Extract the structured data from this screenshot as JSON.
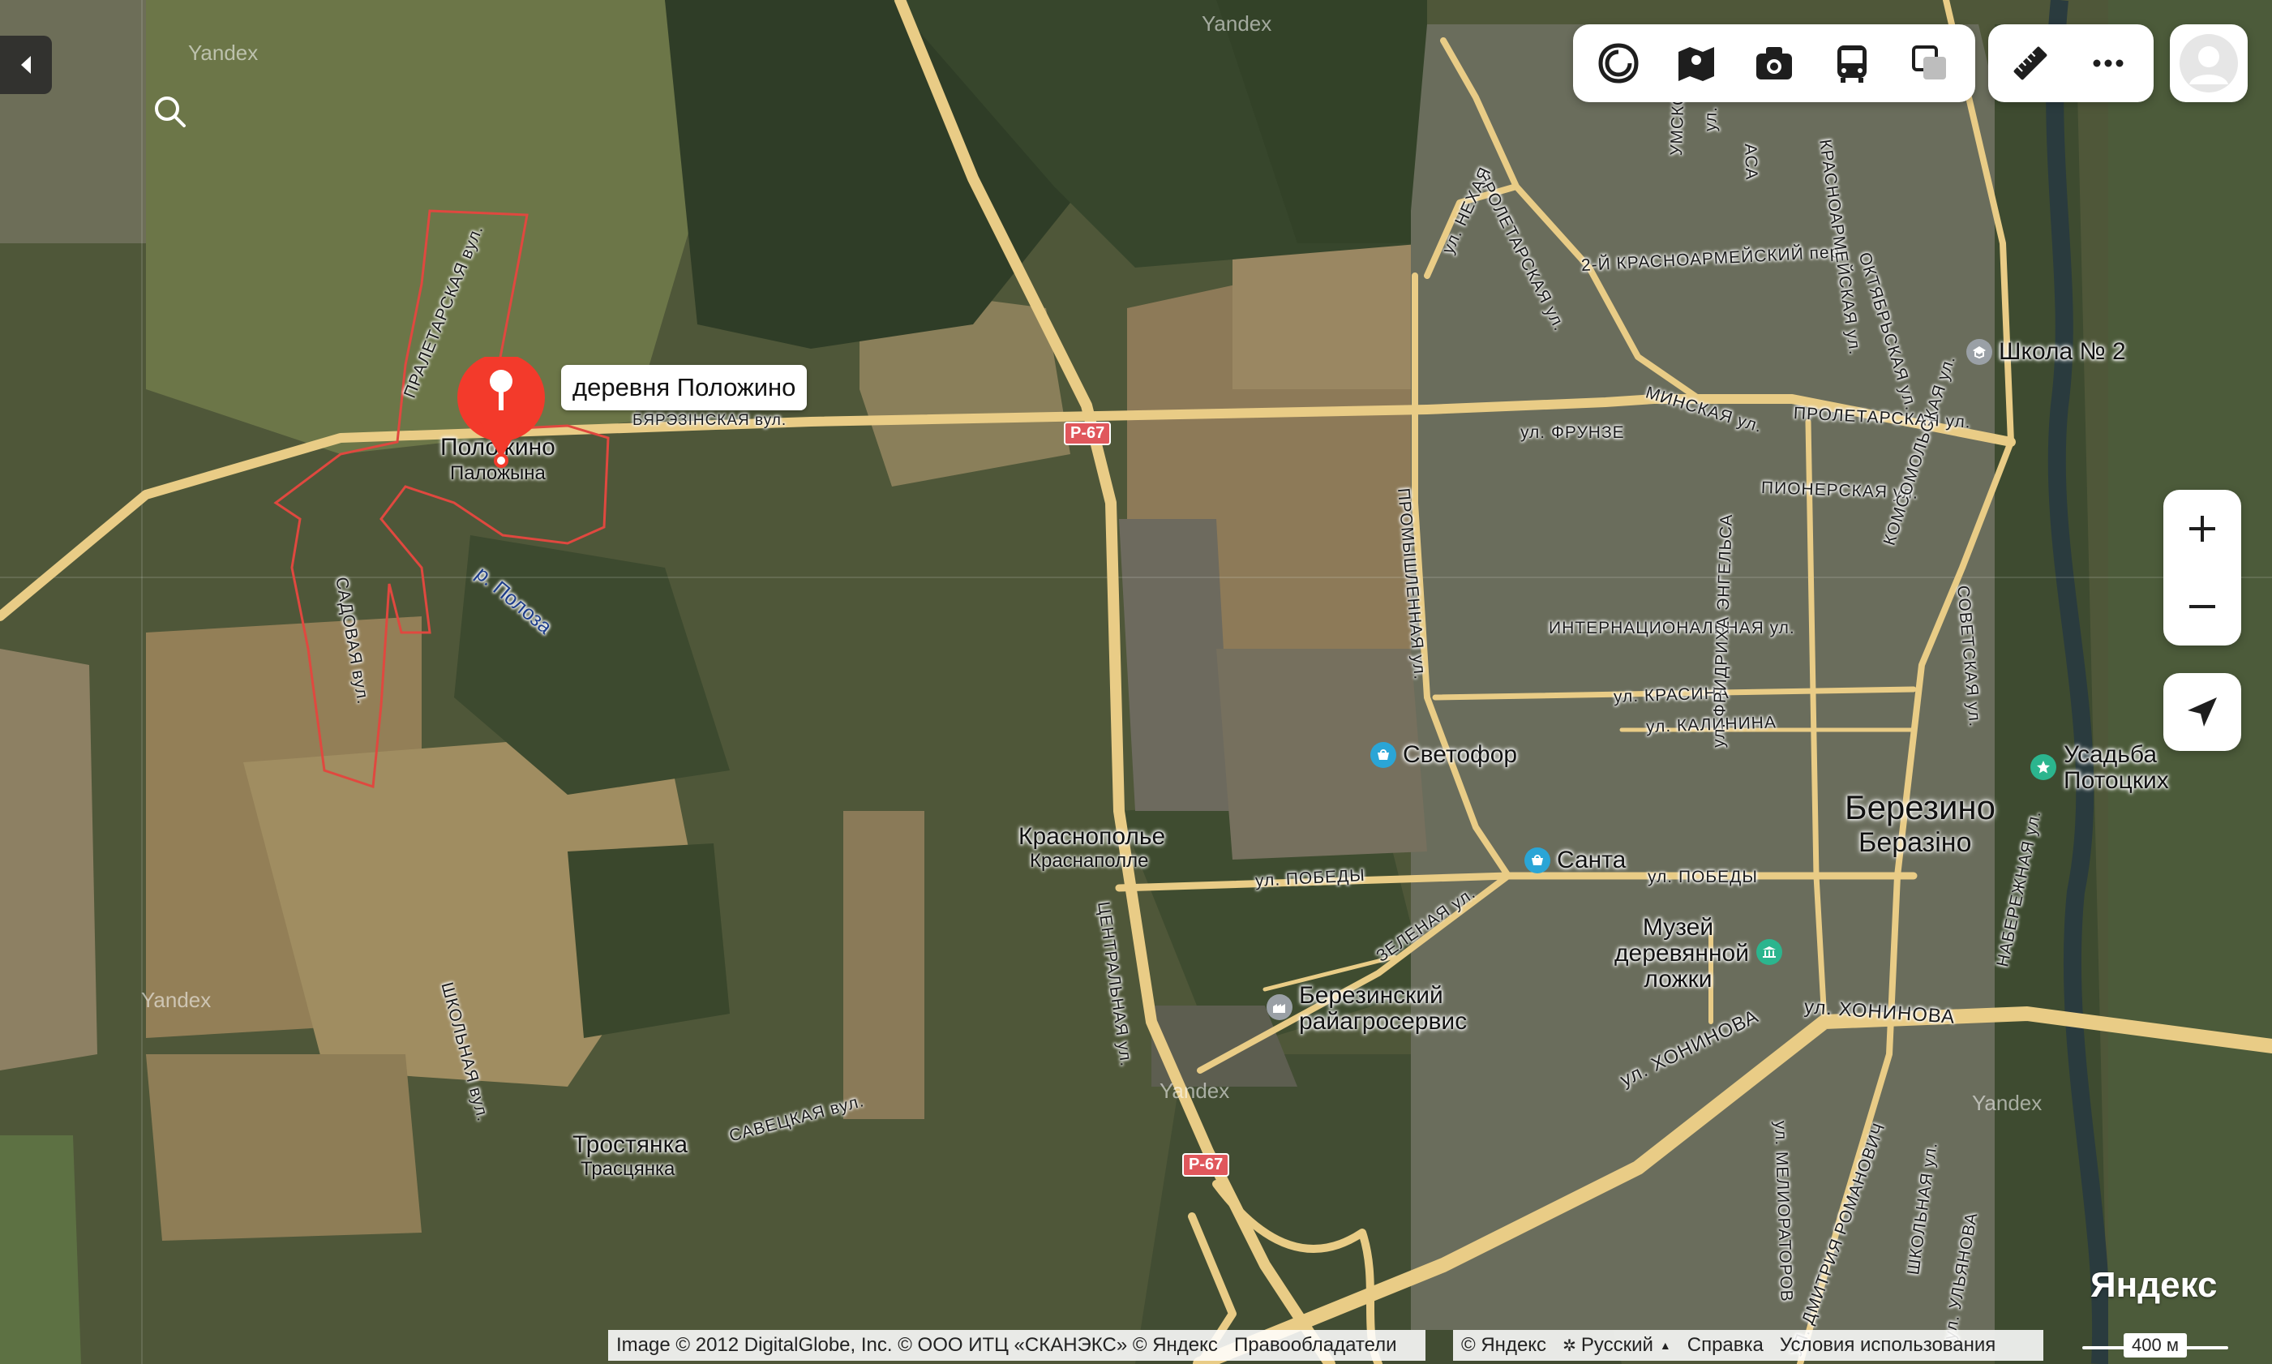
{
  "map": {
    "watermark": "Yandex",
    "logo": "Яндекс",
    "scale_label": "400 м",
    "marker_label": "деревня Положино",
    "copyright": "Image © 2012 DigitalGlobe, Inc. © ООО ИТЦ «СКАНЭКС» © Яндекс",
    "rights_link": "Правообладатели",
    "footer": {
      "yandex": "© Яндекс",
      "language": "Русский",
      "help": "Справка",
      "terms": "Условия использования"
    },
    "road_signs": [
      "Р-67",
      "Р-67"
    ],
    "places": {
      "polozhino": "Положино",
      "polozhino_by": "Паложына",
      "krasnopole": "Краснополье",
      "krasnopole_by": "Краснаполле",
      "trostyanka": "Тростянка",
      "trostyanka_by": "Трасцянка",
      "berezino": "Березино",
      "berezino_by": "Беразіно"
    },
    "pois": {
      "school": "Школа № 2",
      "svetofor": "Светофор",
      "santa": "Санта",
      "usadba_line1": "Усадьба",
      "usadba_line2": "Потоцких",
      "museum_line1": "Музей",
      "museum_line2": "деревянной",
      "museum_line3": "ложки",
      "agro_line1": "Березинский",
      "agro_line2": "райагросервис"
    },
    "streets": {
      "praletarskaya": "ПРАЛЕТАРСКАЯ вул.",
      "byarezinskaya": "БЯРЭЗІНСКАЯ вул.",
      "sadovaya": "САДОВАЯ вул.",
      "shkolnaya": "ШКОЛЬНАЯ вул.",
      "river": "р. Полоза",
      "savetskaya": "САВЕЦКАЯ вул.",
      "tsentralnaya": "ЦЕНТРАЛЬНАЯ ул.",
      "promyshlennaya": "ПРОМЫШЛЕННАЯ ул.",
      "proletarskaya_ne": "ПРОЛЕТАРСКАЯ ул.",
      "nehaya": "ул. НЕХАЯ",
      "minskaya": "МИНСКАЯ ул.",
      "frunze": "ул. ФРУНЗЕ",
      "proletarskaya_e": "ПРОЛЕТАРСКАЯ ул.",
      "pionerskaya": "ПИОНЕРСКАЯ ул.",
      "second_krasnoarm": "2-Й КРАСНОАРМЕЙСКИЙ пер.",
      "krasnoarmeyskaya": "КРАСНОАРМЕЙСКАЯ ул.",
      "oktyabrskaya": "ОКТЯБРЬСКАЯ ул.",
      "internatsionalnaya": "ИНТЕРНАЦИОНАЛЬНАЯ ул.",
      "krasina": "ул. КРАСИНА",
      "kalinina": "ул. КАЛИНИНА",
      "engelsa": "ул. ФРИДРИХА ЭНГЕЛЬСА",
      "komsomolskaya": "КОМСОМОЛЬСКАЯ ул.",
      "sovetskaya": "СОВЕТСКАЯ ул.",
      "pobedy_w": "ул. ПОБЕДЫ",
      "pobedy_e": "ул. ПОБЕДЫ",
      "zelenaya": "ЗЕЛЕНАЯ ул.",
      "khoninova_1": "ул. ХОНИНОВА",
      "khoninova_2": "ул. ХОНИНОВА",
      "naberezhnaya": "НАБЕРЕЖНАЯ ул.",
      "melioratorov": "ул. МЕЛИОРАТОРОВ",
      "romanovich": "УЛ. ДМИТРИЯ РОМАНОВИЧ",
      "shkolnaya_e": "ШКОЛЬНАЯ ул.",
      "ulyanova": "ул. УЛЬЯНОВА",
      "umskogo": "УМСКОГО",
      "ul_top": "ул.",
      "asa": "АСА"
    },
    "toolbar": [
      "layers-icon",
      "map-book-icon",
      "panorama-camera-icon",
      "transit-bus-icon",
      "overlay-squares-icon"
    ],
    "toolbar2": [
      "ruler-icon",
      "more-icon"
    ],
    "colors": {
      "road": "#e9cc86",
      "marker": "#f33a2b",
      "boundary": "#e0483f"
    }
  }
}
